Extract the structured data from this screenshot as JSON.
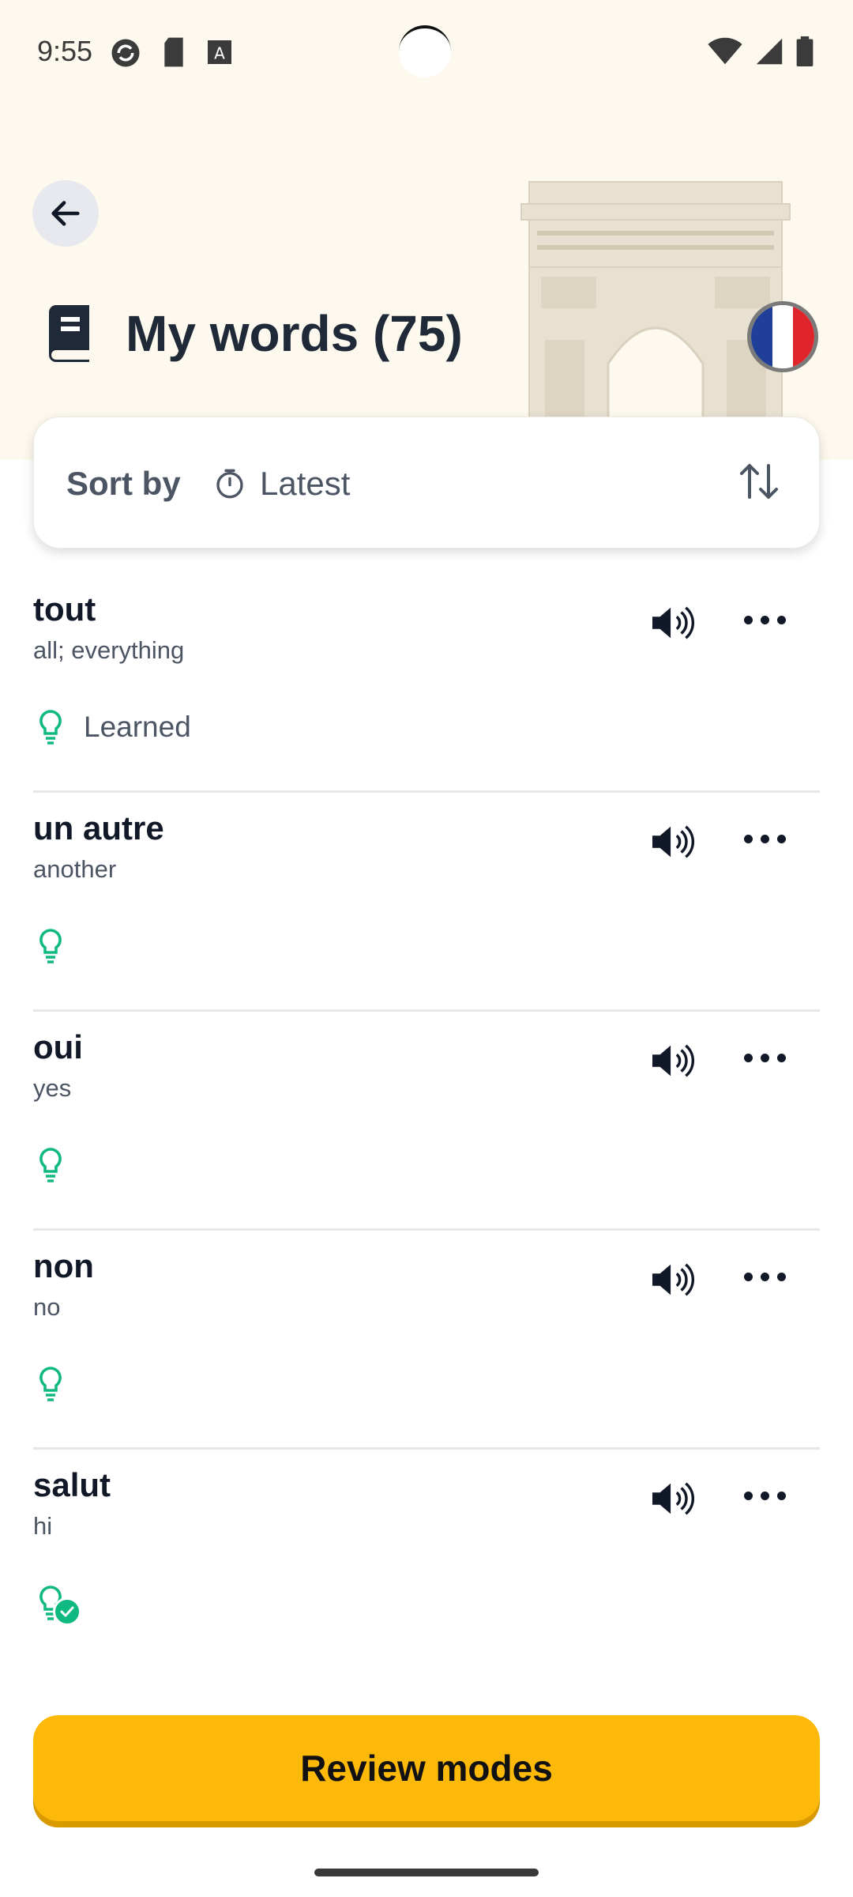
{
  "status_bar": {
    "time": "9:55"
  },
  "header": {
    "title": "My words (75)",
    "language_flag": "france"
  },
  "sort": {
    "label": "Sort by",
    "value": "Latest"
  },
  "words": [
    {
      "term": "tout",
      "translation": "all; everything",
      "status": "Learned"
    },
    {
      "term": "un autre",
      "translation": "another",
      "status": ""
    },
    {
      "term": "oui",
      "translation": "yes",
      "status": ""
    },
    {
      "term": "non",
      "translation": "no",
      "status": ""
    },
    {
      "term": "salut",
      "translation": "hi",
      "status": ""
    }
  ],
  "footer": {
    "review_label": "Review modes"
  },
  "colors": {
    "accent": "#fdb909",
    "learned_green": "#10b981",
    "header_bg": "#fdf9ee"
  }
}
